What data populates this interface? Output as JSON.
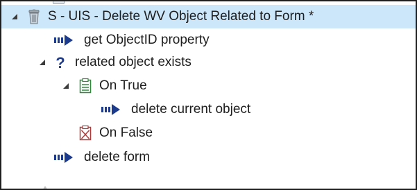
{
  "tree": {
    "nodes": [
      {
        "label": "S - UIS - Delete WV Object Related to Form *",
        "icon": "trash-icon",
        "expanded": true,
        "selected": true
      },
      {
        "label": "get ObjectID property",
        "icon": "action-arrow-icon"
      },
      {
        "label": "related object exists",
        "icon": "question-icon",
        "expanded": true
      },
      {
        "label": "On True",
        "icon": "true-branch-icon",
        "expanded": true
      },
      {
        "label": "delete current object",
        "icon": "action-arrow-icon"
      },
      {
        "label": "On False",
        "icon": "false-branch-icon"
      },
      {
        "label": "delete form",
        "icon": "action-arrow-icon"
      }
    ]
  },
  "colors": {
    "selection": "#cce6fa",
    "action_arrow": "#1d3b8c",
    "question": "#1d3b8c",
    "true_branch": "#2e8b3a",
    "false_branch": "#b23a3a"
  }
}
